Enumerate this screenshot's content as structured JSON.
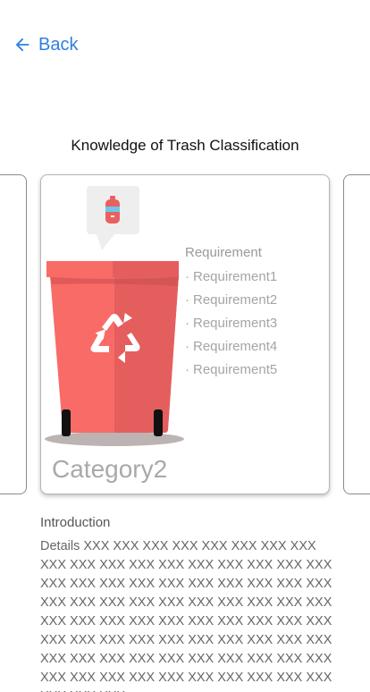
{
  "nav": {
    "back_label": "Back",
    "back_icon": "arrow-left-icon",
    "accent_color": "#2f7fe0"
  },
  "title": "Knowledge of Trash Classification",
  "card": {
    "category": "Category2",
    "bin_color": "#f96b66",
    "requirement_heading": "Requirement",
    "requirements": [
      "Requirement1",
      "Requirement2",
      "Requirement3",
      "Requirement4",
      "Requirement5"
    ],
    "bullet": "·"
  },
  "introduction": {
    "heading": "Introduction",
    "details": "Details XXX XXX XXX XXX XXX XXX XXX XXX XXX XXX XXX XXX XXX XXX XXX XXX XXX XXX XXX XXX XXX XXX XXX XXX XXX XXX XXX XXX XXX XXX XXX XXX XXX XXX XXX XXX XXX XXX XXX XXX XXX XXX XXX XXX XXX XXX XXX XXX XXX XXX XXX XXX XXX XXX XXX XXX XXX XXX XXX XXX XXX XXX XXX XXX XXX XXX XXX XXX XXX XXX XXX XXX XXX XXX XXX XXX XXX XXX XXX XXX XXX"
  }
}
